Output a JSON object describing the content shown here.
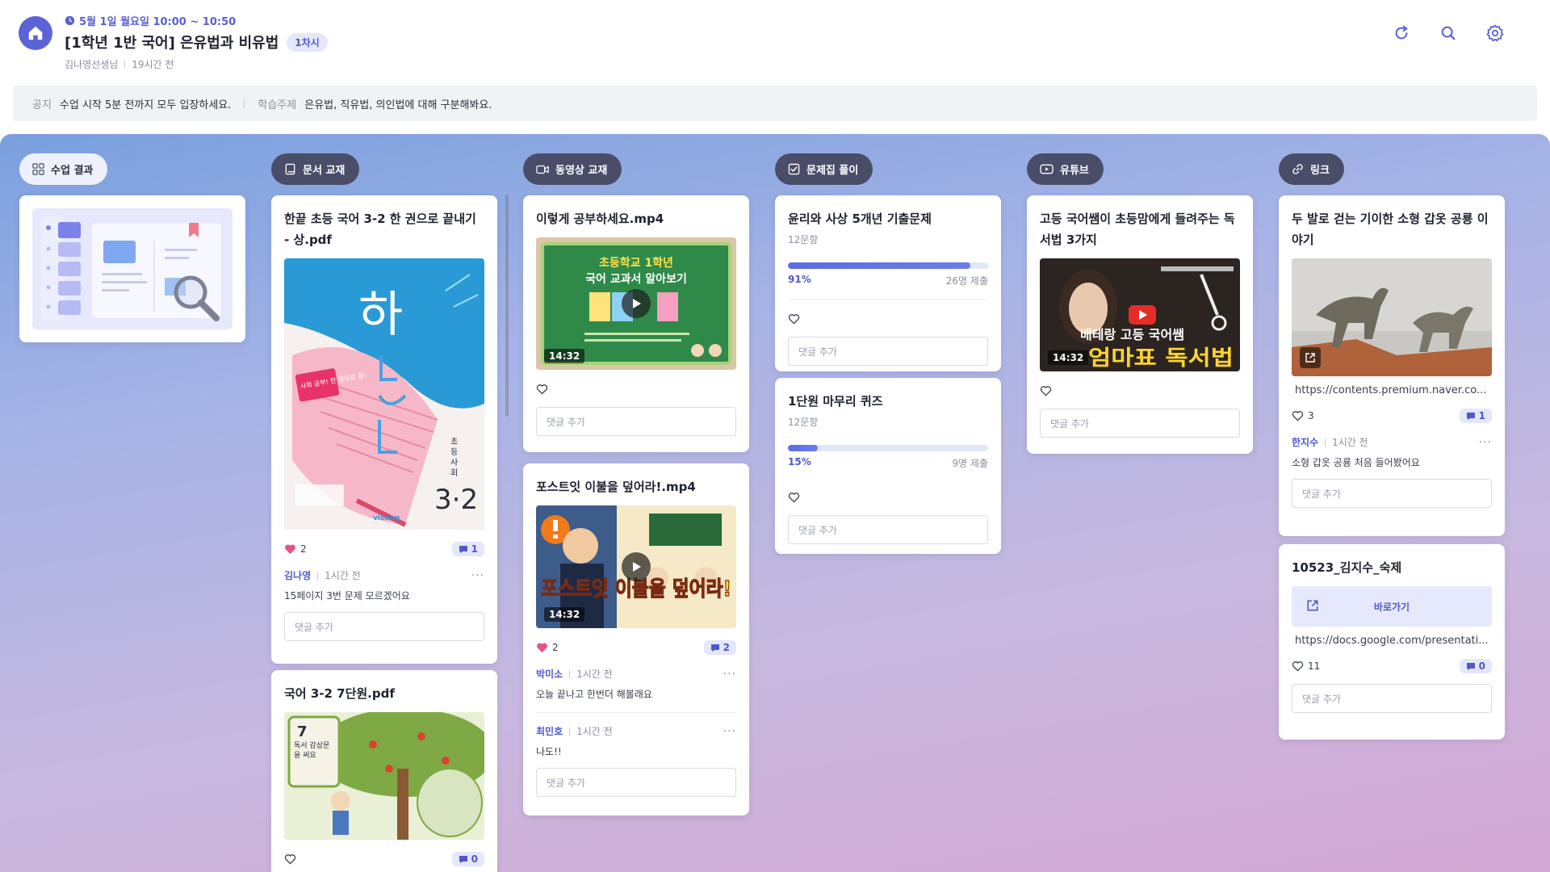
{
  "header": {
    "date": "5월 1일 월요일 10:00 ~ 10:50",
    "title": "[1학년 1반 국어] 은유법과 비유법",
    "session_badge": "1차시",
    "author": "김나영선생님",
    "time_ago": "19시간 전",
    "icons": [
      "refresh-icon",
      "search-icon",
      "gear-icon"
    ]
  },
  "notice": {
    "label": "공지",
    "text": "수업 시작 5분 전까지 모두 입장하세요.",
    "topic_label": "학습주제",
    "topic_text": "은유법, 직유법, 의인법에 대해 구분해봐요."
  },
  "columns": {
    "results": {
      "label": "수업 결과"
    },
    "docs": {
      "label": "문서 교재",
      "cards": [
        {
          "title": "한끝 초등 국어 3-2 한 권으로 끝내기 - 상.pdf",
          "cover_big": "하",
          "cover_small_1": "초",
          "cover_small_2": "등",
          "cover_small_3": "사",
          "cover_small_4": "회",
          "cover_grade": "3·2",
          "cover_brand": "visang",
          "cover_sticker": "사회 공부! 한 권으로 끝!",
          "likes": "2",
          "comments": "1",
          "comment": {
            "name": "김나영",
            "time": "1시간 전",
            "text": "15페이지 3번 문제 모르겠어요"
          },
          "input_placeholder": "댓글 추가"
        },
        {
          "title": "국어 3-2 7단원.pdf",
          "cover_unit": "7",
          "cover_text": "독서 감상문을 써요",
          "likes": "",
          "comments": "0"
        }
      ]
    },
    "videos": {
      "label": "동영상 교재",
      "cards": [
        {
          "title": "이렇게 공부하세요.mp4",
          "thumb_line1": "초등학교 1학년",
          "thumb_line2": "국어 교과서 알아보기",
          "duration": "14:32",
          "input_placeholder": "댓글 추가"
        },
        {
          "title": "포스트잇 이불을 덮어라!.mp4",
          "thumb_text": "포스트잇 이불을 덮어라!",
          "duration": "14:32",
          "likes": "2",
          "comments": "2",
          "comments_list": [
            {
              "name": "박미소",
              "time": "1시간 전",
              "text": "오늘 끝나고 한번더 해볼래요"
            },
            {
              "name": "최민호",
              "time": "1시간 전",
              "text": "나도!!"
            }
          ],
          "input_placeholder": "댓글 추가"
        }
      ]
    },
    "quiz": {
      "label": "문제집 풀이",
      "cards": [
        {
          "title": "윤리와 사상 5개년 기출문제",
          "count": "12문항",
          "percent": 91,
          "percent_label": "91%",
          "submitted": "26명 제출",
          "input_placeholder": "댓글 추가"
        },
        {
          "title": "1단원 마무리 퀴즈",
          "count": "12문항",
          "percent": 15,
          "percent_label": "15%",
          "submitted": "9명 제출",
          "input_placeholder": "댓글 추가"
        }
      ]
    },
    "youtube": {
      "label": "유튜브",
      "cards": [
        {
          "title": "고등 국어쌤이 초등맘에게 들려주는 독서법 3가지",
          "thumb_line1": "배테랑 고등 국어쌤",
          "thumb_line2": "엄마표 독서법",
          "duration": "14:32",
          "input_placeholder": "댓글 추가"
        }
      ]
    },
    "links": {
      "label": "링크",
      "cards": [
        {
          "title": "두 발로 걷는 기이한 소형 갑옷 공룡 이야기",
          "url": "https://contents.premium.naver.co...",
          "likes": "3",
          "comments": "1",
          "comment": {
            "name": "한지수",
            "time": "1시간 전",
            "text": "소형 갑옷 공룡 처음 들어봤어요"
          },
          "input_placeholder": "댓글 추가"
        },
        {
          "title": "10523_김지수_숙제",
          "button": "바로가기",
          "url": "https://docs.google.com/presentati...",
          "likes": "11",
          "comments": "0",
          "input_placeholder": "댓글 추가"
        }
      ]
    }
  },
  "colors": {
    "accent": "#5b63d6",
    "chip_dark": "#4a4d68",
    "like_pink": "#e8508a"
  }
}
